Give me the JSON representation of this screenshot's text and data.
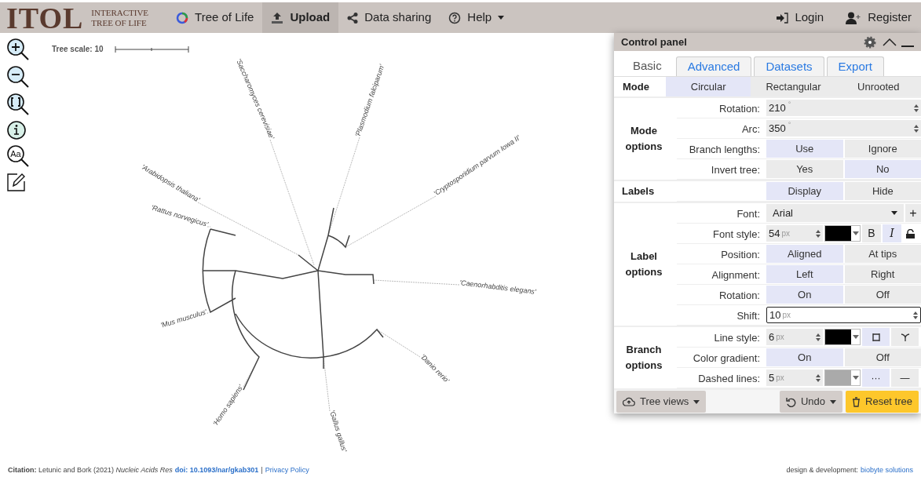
{
  "navbar": {
    "logo": "ITOL",
    "logo_sub": [
      "INTERACTIVE",
      "TREE OF LIFE"
    ],
    "items": [
      {
        "kind": "tree",
        "label": "Tree of Life",
        "selected": false
      },
      {
        "kind": "upload",
        "label": "Upload",
        "selected": true
      },
      {
        "kind": "share",
        "label": "Data sharing",
        "selected": false
      },
      {
        "kind": "help",
        "label": "Help",
        "selected": false
      }
    ],
    "right_items": [
      {
        "kind": "login",
        "label": "Login"
      },
      {
        "kind": "register",
        "label": "Register"
      }
    ]
  },
  "left_toolbar": [
    {
      "kind": "zoom_in"
    },
    {
      "kind": "zoom_out"
    },
    {
      "kind": "zoom_fit"
    },
    {
      "kind": "info"
    },
    {
      "kind": "label_zoom",
      "text": "Aa"
    },
    {
      "kind": "edit"
    }
  ],
  "tree": {
    "scale_label": "Tree scale: 10",
    "leaves": [
      {
        "label": "'Saccharomyces cerevisiae'"
      },
      {
        "label": "'Plasmodium falciparum'"
      },
      {
        "label": "'Cryptosporidium parvum Iowa II'"
      },
      {
        "label": "'Caenorhabditis elegans'"
      },
      {
        "label": "'Danio rerio'"
      },
      {
        "label": "'Gallus gallus'"
      },
      {
        "label": "'Homo sapiens'"
      },
      {
        "label": "'Mus musculus'"
      },
      {
        "label": "'Rattus norvegicus'"
      },
      {
        "label": "'Arabidopsis thaliana'"
      }
    ]
  },
  "control_panel": {
    "title": "Control panel",
    "tabs": [
      {
        "label": "Basic",
        "selected": true
      },
      {
        "label": "Advanced",
        "selected": false
      },
      {
        "label": "Datasets",
        "selected": false
      },
      {
        "label": "Export",
        "selected": false
      }
    ],
    "sections": [
      {
        "kind": "bar",
        "title": "Mode",
        "options": [
          {
            "label": "Circular",
            "selected": true
          },
          {
            "label": "Rectangular",
            "selected": false
          },
          {
            "label": "Unrooted",
            "selected": false
          }
        ]
      },
      {
        "kind": "group",
        "title": "Mode options",
        "rows": [
          {
            "kind": "number",
            "label": "Rotation:",
            "value": "210",
            "unit": "°"
          },
          {
            "kind": "number",
            "label": "Arc:",
            "value": "350",
            "unit": "°"
          },
          {
            "kind": "toggle",
            "label": "Branch lengths:",
            "options": [
              {
                "label": "Use",
                "selected": true
              },
              {
                "label": "Ignore",
                "selected": false
              }
            ]
          },
          {
            "kind": "toggle",
            "label": "Invert tree:",
            "options": [
              {
                "label": "Yes",
                "selected": false
              },
              {
                "label": "No",
                "selected": true
              }
            ]
          }
        ]
      },
      {
        "kind": "group",
        "title": "Labels",
        "rows": [
          {
            "kind": "toggle",
            "options": [
              {
                "label": "Display",
                "selected": true
              },
              {
                "label": "Hide",
                "selected": false
              }
            ]
          }
        ]
      },
      {
        "kind": "group",
        "title": "Label options",
        "rows": [
          {
            "kind": "select",
            "label": "Font:",
            "value": "Arial",
            "add": "+"
          },
          {
            "kind": "font_style",
            "label": "Font style:",
            "value": "54",
            "unit": "px",
            "color": "#000000",
            "bold": {
              "label": "B",
              "selected": false
            },
            "italic": {
              "label": "I",
              "selected": true
            }
          },
          {
            "kind": "toggle",
            "label": "Position:",
            "options": [
              {
                "label": "Aligned",
                "selected": true
              },
              {
                "label": "At tips",
                "selected": false
              }
            ]
          },
          {
            "kind": "toggle",
            "label": "Alignment:",
            "options": [
              {
                "label": "Left",
                "selected": true
              },
              {
                "label": "Right",
                "selected": false
              }
            ]
          },
          {
            "kind": "toggle",
            "label": "Rotation:",
            "options": [
              {
                "label": "On",
                "selected": true
              },
              {
                "label": "Off",
                "selected": false
              }
            ]
          },
          {
            "kind": "number",
            "label": "Shift:",
            "value": "10",
            "unit": "px",
            "focused": true
          }
        ]
      },
      {
        "kind": "group",
        "title": "Branch options",
        "rows": [
          {
            "kind": "line_style",
            "label": "Line style:",
            "value": "6",
            "unit": "px",
            "color": "#000000",
            "options": [
              {
                "kind": "square",
                "selected": true
              },
              {
                "kind": "curved",
                "selected": false
              }
            ]
          },
          {
            "kind": "toggle",
            "label": "Color gradient:",
            "options": [
              {
                "label": "On",
                "selected": true
              },
              {
                "label": "Off",
                "selected": false
              }
            ]
          },
          {
            "kind": "dashed",
            "label": "Dashed lines:",
            "value": "5",
            "unit": "px",
            "color": "#aaaaaa",
            "options": [
              {
                "label": "···",
                "selected": true
              },
              {
                "label": "—",
                "selected": false
              }
            ]
          }
        ]
      }
    ],
    "footer": {
      "tree_views": "Tree views",
      "undo": "Undo",
      "reset": "Reset tree"
    }
  },
  "footer": {
    "citation": "**Citation:** Letunic and Bork (2021) *Nucleic Acids Res*",
    "doi": "doi: 10.1093/nar/gkab301",
    "separator": "|",
    "privacy": "Privacy Policy",
    "credit": "design & development:",
    "credit_link": "biobyte solutions"
  }
}
